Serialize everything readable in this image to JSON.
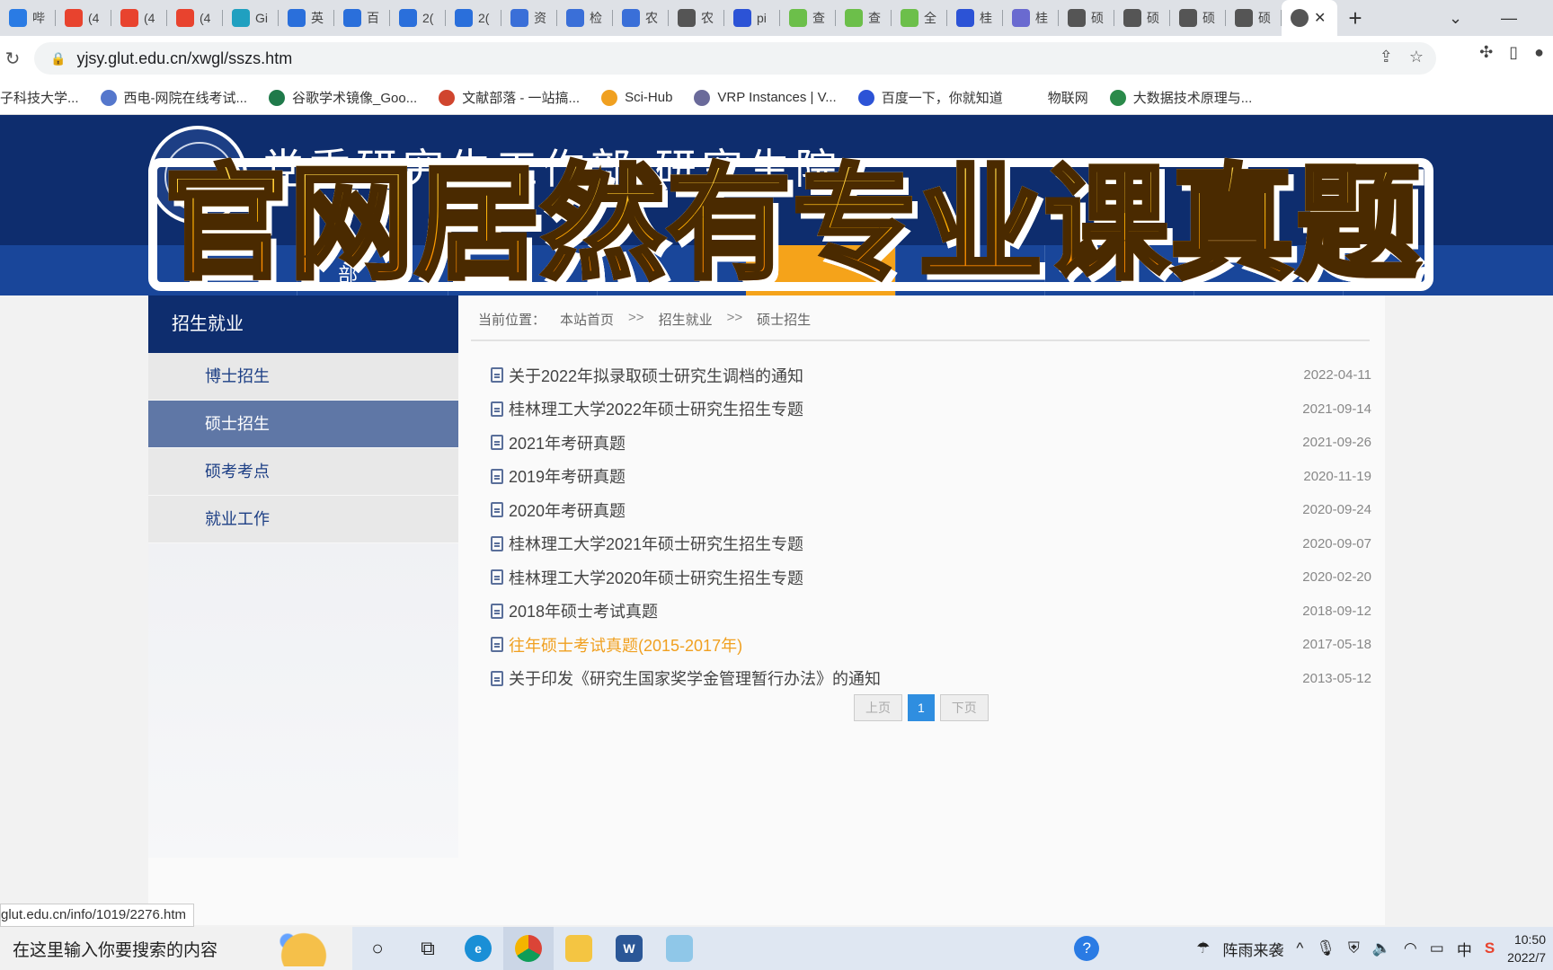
{
  "browser": {
    "tabs": [
      {
        "icon": "baidu-icon",
        "label": "哔",
        "color": "#2a7be4"
      },
      {
        "icon": "c-icon",
        "label": "(4",
        "color": "#e8432e"
      },
      {
        "icon": "c-icon",
        "label": "(4",
        "color": "#e8432e"
      },
      {
        "icon": "c-icon",
        "label": "(4",
        "color": "#e8432e"
      },
      {
        "icon": "swirl-icon",
        "label": "Gi",
        "color": "#20a0c0"
      },
      {
        "icon": "baike-icon",
        "label": "英",
        "color": "#2a6fdb"
      },
      {
        "icon": "translate-icon",
        "label": "百",
        "color": "#2a6fdb"
      },
      {
        "icon": "baike-icon",
        "label": "2(",
        "color": "#2a6fdb"
      },
      {
        "icon": "baike-icon",
        "label": "2(",
        "color": "#2a6fdb"
      },
      {
        "icon": "doc-icon",
        "label": "资",
        "color": "#3a6fd8"
      },
      {
        "icon": "doc-icon",
        "label": "检",
        "color": "#3a6fd8"
      },
      {
        "icon": "doc-icon",
        "label": "农",
        "color": "#3a6fd8"
      },
      {
        "icon": "globe-icon",
        "label": "农",
        "color": "#555555"
      },
      {
        "icon": "paw-icon",
        "label": "pi",
        "color": "#2c53d6"
      },
      {
        "icon": "leaf-icon",
        "label": "查",
        "color": "#6cbf4a"
      },
      {
        "icon": "leaf-icon",
        "label": "查",
        "color": "#6cbf4a"
      },
      {
        "icon": "leaf-icon",
        "label": "全",
        "color": "#6cbf4a"
      },
      {
        "icon": "paw-icon",
        "label": "桂",
        "color": "#2c53d6"
      },
      {
        "icon": "seal-icon",
        "label": "桂",
        "color": "#6a6ad0"
      },
      {
        "icon": "globe-icon",
        "label": "硕",
        "color": "#555555"
      },
      {
        "icon": "globe-icon",
        "label": "硕",
        "color": "#555555"
      },
      {
        "icon": "globe-icon",
        "label": "硕",
        "color": "#555555"
      },
      {
        "icon": "globe-icon",
        "label": "硕",
        "color": "#555555"
      }
    ],
    "url": "yjsy.glut.edu.cn/xwgl/sszs.htm",
    "bookmarks": [
      {
        "label": "子科技大学...",
        "color": "#c44"
      },
      {
        "label": "西电-网院在线考试...",
        "color": "#5577cc"
      },
      {
        "label": "谷歌学术镜像_Goo...",
        "color": "#1f7a4a"
      },
      {
        "label": "文献部落 - 一站搞...",
        "color": "#d0452e"
      },
      {
        "label": "Sci-Hub",
        "color": "#f0a020"
      },
      {
        "label": "VRP Instances | V...",
        "color": "#6a6a9a"
      },
      {
        "label": "百度一下，你就知道",
        "color": "#2c53d6"
      },
      {
        "label": "物联网",
        "color": "#ffffff"
      },
      {
        "label": "大数据技术原理与...",
        "color": "#2a8a4a"
      }
    ]
  },
  "site": {
    "title": "党委研究生工作部 研究生院",
    "nav_label": "部",
    "banner": "官网居然有专业课真题"
  },
  "sidebar": {
    "heading": "招生就业",
    "items": [
      {
        "label": "博士招生"
      },
      {
        "label": "硕士招生"
      },
      {
        "label": "硕考考点"
      },
      {
        "label": "就业工作"
      }
    ]
  },
  "breadcrumb": {
    "prefix": "当前位置：",
    "home": "本站首页",
    "sep": ">>",
    "section": "招生就业",
    "current": "硕士招生"
  },
  "articles": [
    {
      "title": "关于2022年拟录取硕士研究生调档的通知",
      "date": "2022-04-11"
    },
    {
      "title": "桂林理工大学2022年硕士研究生招生专题",
      "date": "2021-09-14"
    },
    {
      "title": "2021年考研真题",
      "date": "2021-09-26"
    },
    {
      "title": "2019年考研真题",
      "date": "2020-11-19"
    },
    {
      "title": "2020年考研真题",
      "date": "2020-09-24"
    },
    {
      "title": "桂林理工大学2021年硕士研究生招生专题",
      "date": "2020-09-07"
    },
    {
      "title": "桂林理工大学2020年硕士研究生招生专题",
      "date": "2020-02-20"
    },
    {
      "title": "2018年硕士考试真题",
      "date": "2018-09-12"
    },
    {
      "title": "往年硕士考试真题(2015-2017年)",
      "date": "2017-05-18"
    },
    {
      "title": "关于印发《研究生国家奖学金管理暂行办法》的通知",
      "date": "2013-05-12"
    }
  ],
  "pager": {
    "prev": "上页",
    "current": "1",
    "next": "下页"
  },
  "status_url": "glut.edu.cn/info/1019/2276.htm",
  "taskbar": {
    "search_placeholder": "在这里输入你要搜索的内容",
    "weather": "阵雨来袭",
    "ime": "中",
    "time": "10:50",
    "date": "2022/7"
  }
}
